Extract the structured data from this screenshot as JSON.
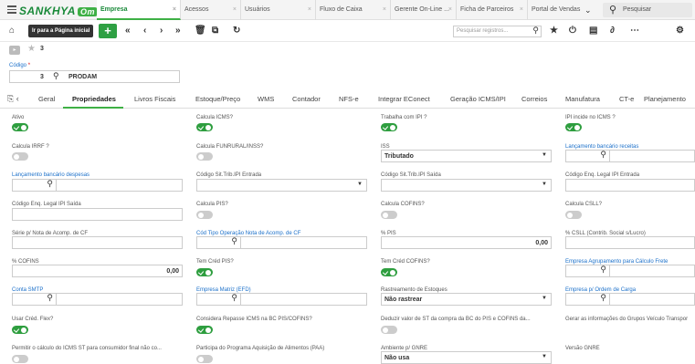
{
  "app": {
    "logo": "SANKHYA",
    "logo_badge": "Om"
  },
  "tabs": [
    {
      "label": "Empresa",
      "active": true
    },
    {
      "label": "Acessos"
    },
    {
      "label": "Usuários"
    },
    {
      "label": "Fluxo de Caixa"
    },
    {
      "label": "Gerente On-Line ..."
    },
    {
      "label": "Ficha de Parceiros"
    },
    {
      "label": "Portal de Vendas"
    }
  ],
  "top_search": {
    "placeholder": "Pesquisar"
  },
  "toolbar": {
    "home_tooltip": "Ir para a Página inicial",
    "add_label": "+",
    "search_placeholder": "Pesquisar registros..."
  },
  "record": {
    "number": "3"
  },
  "codigo": {
    "label": "Código",
    "required_mark": "*",
    "value": "3",
    "name": "PRODAM"
  },
  "page_tabs": [
    "Geral",
    "Propriedades",
    "Livros Fiscais",
    "Estoque/Preço",
    "WMS",
    "Contador",
    "NFS-e",
    "Integrar EConect",
    "Geração ICMS/IPI",
    "Correios",
    "Manufatura",
    "CT-e",
    "Planejamento"
  ],
  "active_tab": "Propriedades",
  "fields": {
    "ativo": {
      "label": "Ativo",
      "on": true
    },
    "calcula_icms": {
      "label": "Calcula ICMS?",
      "on": true
    },
    "trabalha_ipi": {
      "label": "Trabalha com IPI ?",
      "on": true
    },
    "ipi_incide_icms": {
      "label": "IPI incide no ICMS ?",
      "on": true
    },
    "calcula_irrf": {
      "label": "Calcula IRRF ?",
      "on": false
    },
    "calcula_funrural": {
      "label": "Calcula FUNRURAL/INSS?",
      "on": false
    },
    "iss": {
      "label": "ISS",
      "value": "Tributado"
    },
    "lanc_receitas": {
      "label": "Lançamento bancário receitas"
    },
    "lanc_despesas": {
      "label": "Lançamento bancário despesas"
    },
    "cod_sit_ipi_entrada": {
      "label": "Código Sit.Trib.IPI Entrada"
    },
    "cod_sit_ipi_saida": {
      "label": "Código Sit.Trib.IPI Saída"
    },
    "cod_enq_ipi_entrada": {
      "label": "Código Enq. Legal IPI Entrada"
    },
    "cod_enq_ipi_saida": {
      "label": "Código Enq. Legal IPI Saída"
    },
    "calcula_pis": {
      "label": "Calcula PIS?",
      "on": false
    },
    "calcula_cofins": {
      "label": "Calcula COFINS?",
      "on": false
    },
    "calcula_csll": {
      "label": "Calcula CSLL?",
      "on": false
    },
    "serie_nota_acomp": {
      "label": "Série p/ Nota de Acomp. de CF"
    },
    "cod_tipo_op_nota": {
      "label": "Cód Tipo Operação Nota de Acomp. de CF"
    },
    "pct_pis": {
      "label": "% PIS",
      "value": "0,00"
    },
    "pct_csll": {
      "label": "% CSLL (Contrib. Social s/Lucro)"
    },
    "pct_cofins": {
      "label": "% COFINS",
      "value": "0,00"
    },
    "tem_cred_pis": {
      "label": "Tem Créd PIS?",
      "on": true
    },
    "tem_cred_cofins": {
      "label": "Tem Créd COFINS?",
      "on": true
    },
    "empresa_agrup_frete": {
      "label": "Empresa Agrupamento para Cálculo Frete"
    },
    "conta_smtp": {
      "label": "Conta SMTP"
    },
    "empresa_matriz": {
      "label": "Empresa Matriz (EFD)"
    },
    "rastreamento": {
      "label": "Rastreamento de Estoques",
      "value": "Não rastrear"
    },
    "empresa_ordem_carga": {
      "label": "Empresa p/ Ordem de Carga"
    },
    "usar_cred_flex": {
      "label": "Usar Créd. Flex?",
      "on": true
    },
    "considera_repasse": {
      "label": "Considera Repasse ICMS na BC PIS/COFINS?",
      "on": true
    },
    "deduzir_st": {
      "label": "Deduzir valor de ST da compra da BC do PIS e COFINS da...",
      "on": false
    },
    "gerar_info_grupos": {
      "label": "Gerar as informações do Grupos Veículo Transpor"
    },
    "permitir_icms_st": {
      "label": "Permitir o cálculo do ICMS ST para consumidor final não co...",
      "on": false
    },
    "participa_paa": {
      "label": "Participa do Programa Aquisição de Alimentos (PAA)",
      "on": false
    },
    "ambiente_gnre": {
      "label": "Ambiente p/ GNRE",
      "value": "Não usa"
    },
    "versao_gnre": {
      "label": "Versão GNRE"
    }
  }
}
